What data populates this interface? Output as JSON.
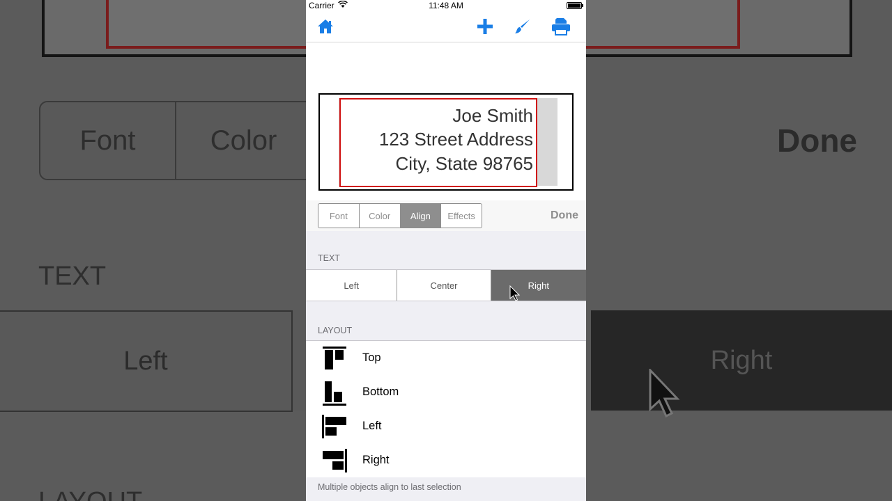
{
  "status_bar": {
    "carrier": "Carrier",
    "time": "11:48 AM"
  },
  "navbar": {
    "icons": [
      "home-icon",
      "plus-icon",
      "brush-icon",
      "printer-icon"
    ],
    "accent": "#1a7ee6"
  },
  "label_preview": {
    "lines": [
      "Joe Smith",
      "123 Street Address",
      "City, State 98765"
    ],
    "border_color": "#d01010"
  },
  "toolbar": {
    "tabs": [
      "Font",
      "Color",
      "Align",
      "Effects"
    ],
    "active_tab": "Align",
    "done_label": "Done"
  },
  "text_section": {
    "header": "TEXT",
    "options": [
      "Left",
      "Center",
      "Right"
    ],
    "selected": "Right"
  },
  "layout_section": {
    "header": "LAYOUT",
    "items": [
      {
        "label": "Top",
        "icon": "align-top-icon"
      },
      {
        "label": "Bottom",
        "icon": "align-bottom-icon"
      },
      {
        "label": "Left",
        "icon": "align-left-icon"
      },
      {
        "label": "Right",
        "icon": "align-right-icon"
      }
    ],
    "footer": "Multiple objects align to last selection"
  }
}
